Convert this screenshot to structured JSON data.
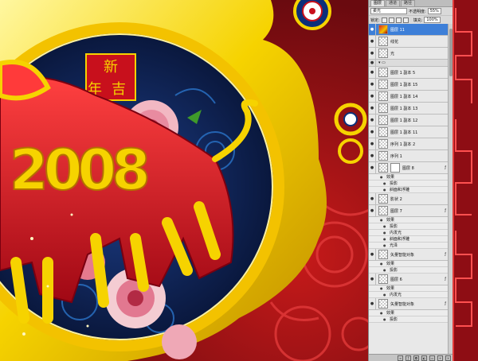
{
  "panel": {
    "tabs": [
      {
        "label": "图层"
      },
      {
        "label": "通道"
      },
      {
        "label": "路径"
      }
    ],
    "blend_mode": "柔光",
    "opacity_label": "不透明度:",
    "opacity_value": "55%",
    "lock_label": "锁定:",
    "fill_label": "填充:",
    "fill_value": "100%"
  },
  "layers": [
    {
      "name": "图层 11",
      "selected": true,
      "thumb": "img"
    },
    {
      "name": "线花"
    },
    {
      "name": "光"
    },
    {
      "name": "图层 1 副本 5"
    },
    {
      "name": "图层 1 副本 15"
    },
    {
      "name": "图层 1 副本 14"
    },
    {
      "name": "图层 1 副本 13"
    },
    {
      "name": "图层 1 副本 12"
    },
    {
      "name": "图层 1 副本 11"
    },
    {
      "name": "序列 1 副本 2"
    },
    {
      "name": "序列 1"
    }
  ],
  "layer_8": {
    "name": "图层 8",
    "effects_label": "效果",
    "effects": [
      "投影",
      "斜面和浮雕"
    ]
  },
  "layer_shadow2": {
    "name": "影状 2"
  },
  "layer_7": {
    "name": "图层 7",
    "effects_label": "效果",
    "effects": [
      "投影",
      "内发光",
      "斜面和浮雕",
      "光泽"
    ]
  },
  "layer_vec1": {
    "name": "矢量智能对象",
    "effects_label": "效果",
    "effects": [
      "投影"
    ]
  },
  "layer_6": {
    "name": "图层 6",
    "effects_label": "效果",
    "effects": [
      "内发光"
    ]
  },
  "layer_vec2": {
    "name": "矢量智能对象",
    "effects_label": "效果",
    "effects": [
      "投影"
    ]
  },
  "canvas": {
    "digits": "2008",
    "seal_line1": "新",
    "seal_line2": "吉",
    "seal_line3": "年"
  },
  "colors": {
    "gold": "#f6d300",
    "red": "#c8101c",
    "navy": "#0b1c4e",
    "selected": "#3d7fd8"
  }
}
